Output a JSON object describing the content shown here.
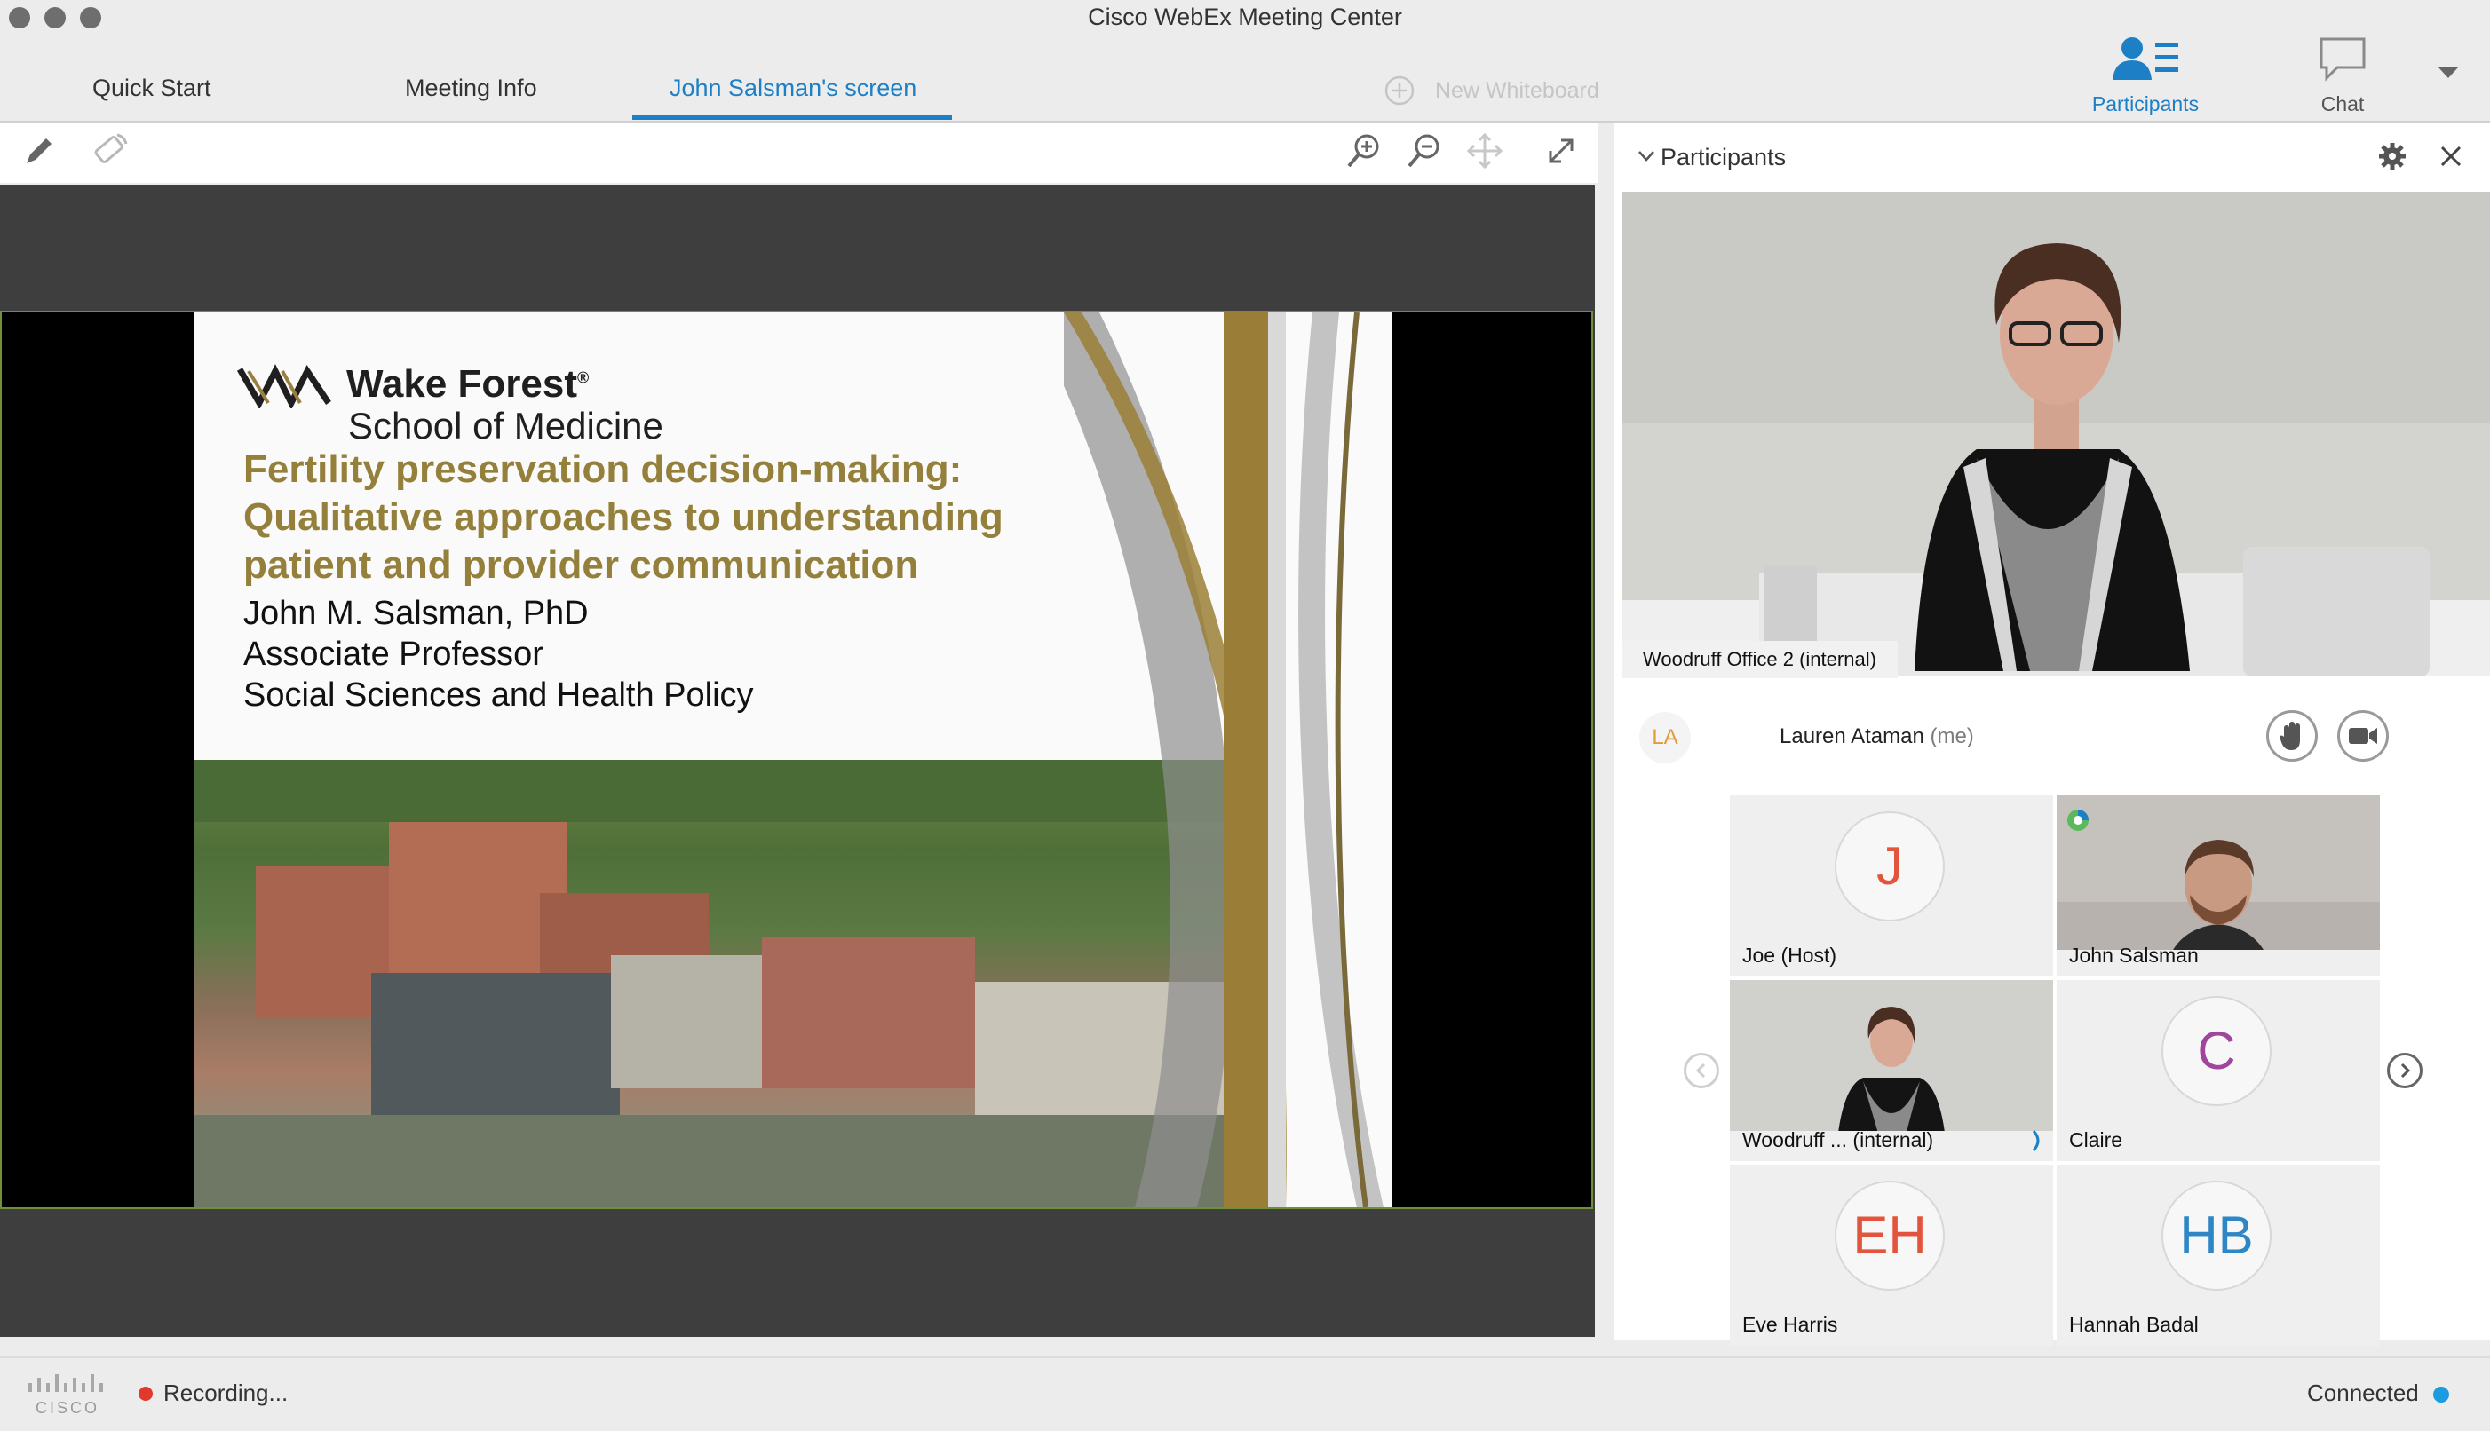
{
  "window": {
    "title": "Cisco WebEx Meeting Center"
  },
  "tabs": [
    {
      "label": "Quick Start"
    },
    {
      "label": "Meeting Info"
    },
    {
      "label": "John Salsman's screen"
    }
  ],
  "new_whiteboard": {
    "label": "New Whiteboard"
  },
  "top_buttons": {
    "participants": {
      "label": "Participants"
    },
    "chat": {
      "label": "Chat"
    }
  },
  "slide": {
    "brand_name": "Wake Forest",
    "brand_school": "School of Medicine",
    "title_lines": [
      "Fertility preservation decision-making:",
      "Qualitative approaches to understanding",
      "patient and provider communication"
    ],
    "presenter": "John M. Salsman, PhD",
    "role": "Associate Professor",
    "department": "Social Sciences and Health Policy"
  },
  "participants_panel": {
    "title": "Participants",
    "main_video_caption": "Woodruff Office 2 (internal)",
    "me": {
      "initials": "LA",
      "name": "Lauren Ataman",
      "suffix": "(me)"
    },
    "tiles": [
      {
        "name": "Joe (Host)",
        "initials": "J",
        "color": "#e2553c",
        "video": false
      },
      {
        "name": "John Salsman",
        "initials": "",
        "color": "",
        "video": true
      },
      {
        "name": "Woodruff ... (internal)",
        "initials": "",
        "color": "",
        "video": true
      },
      {
        "name": "Claire",
        "initials": "C",
        "color": "#a0459c",
        "video": false
      },
      {
        "name": "Eve Harris",
        "initials": "EH",
        "color": "#e2553c",
        "video": false
      },
      {
        "name": "Hannah Badal",
        "initials": "HB",
        "color": "#2f86c6",
        "video": false
      }
    ]
  },
  "status": {
    "recording": "Recording...",
    "connection": "Connected",
    "logo_text": "CISCO"
  },
  "colors": {
    "accent": "#1d7fc6",
    "slide_title": "#94803a",
    "recording": "#e13a2d",
    "connected": "#1d9be0"
  }
}
